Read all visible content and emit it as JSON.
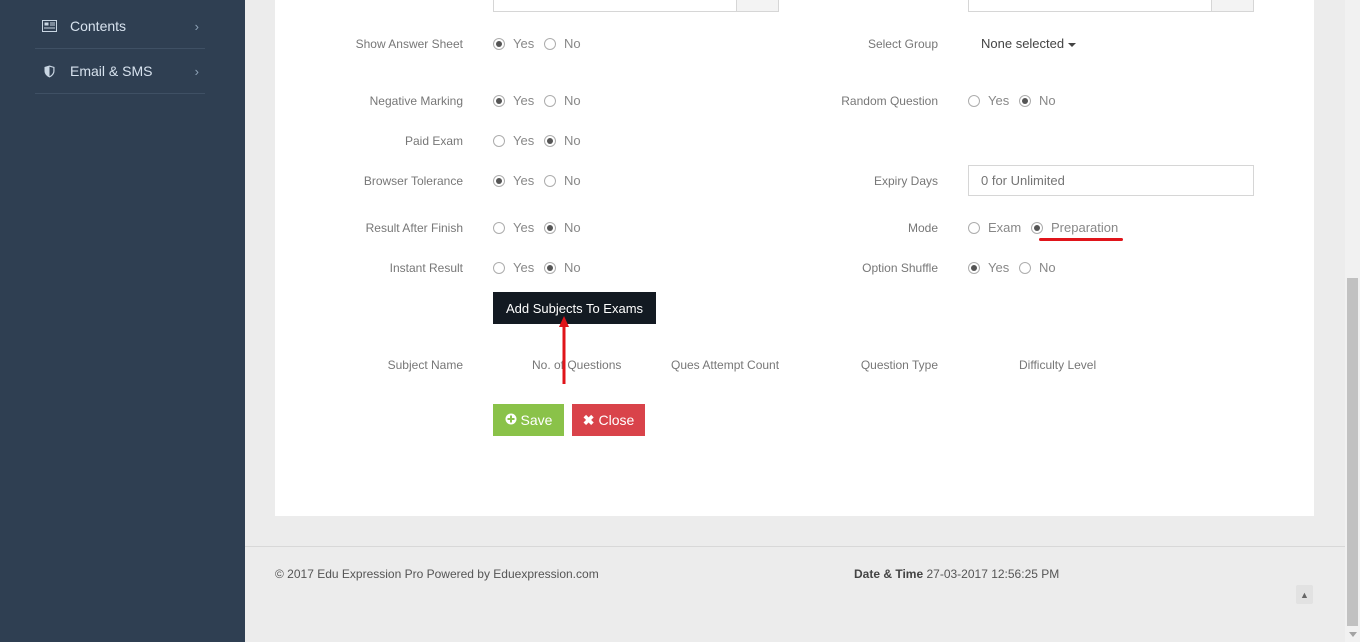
{
  "sidebar": {
    "items": [
      {
        "label": "Contents",
        "icon": "newspaper-icon"
      },
      {
        "label": "Email & SMS",
        "icon": "shield-icon"
      }
    ]
  },
  "form": {
    "show_answer_sheet": {
      "label": "Show Answer Sheet",
      "yes": "Yes",
      "no": "No",
      "selected": "Yes"
    },
    "select_group": {
      "label": "Select Group",
      "value": "None selected"
    },
    "negative_marking": {
      "label": "Negative Marking",
      "yes": "Yes",
      "no": "No",
      "selected": "Yes"
    },
    "random_question": {
      "label": "Random Question",
      "yes": "Yes",
      "no": "No",
      "selected": "No"
    },
    "paid_exam": {
      "label": "Paid Exam",
      "yes": "Yes",
      "no": "No",
      "selected": "No"
    },
    "browser_tolerance": {
      "label": "Browser Tolerance",
      "yes": "Yes",
      "no": "No",
      "selected": "Yes"
    },
    "expiry_days": {
      "label": "Expiry Days",
      "placeholder": "0 for Unlimited"
    },
    "result_after_finish": {
      "label": "Result After Finish",
      "yes": "Yes",
      "no": "No",
      "selected": "No"
    },
    "mode": {
      "label": "Mode",
      "exam": "Exam",
      "preparation": "Preparation",
      "selected": "Preparation"
    },
    "instant_result": {
      "label": "Instant Result",
      "yes": "Yes",
      "no": "No",
      "selected": "No"
    },
    "option_shuffle": {
      "label": "Option Shuffle",
      "yes": "Yes",
      "no": "No",
      "selected": "Yes"
    }
  },
  "add_subjects_button": "Add Subjects To Exams",
  "subject_table": {
    "headers": [
      "Subject Name",
      "No. of Questions",
      "Ques Attempt Count",
      "Question Type",
      "Difficulty Level"
    ]
  },
  "actions": {
    "save": "Save",
    "close": "Close"
  },
  "footer": {
    "copyright": "© 2017 Edu Expression Pro Powered by Eduexpression.com",
    "datetime_label": "Date & Time",
    "datetime_value": "27-03-2017 12:56:25 PM"
  },
  "colors": {
    "sidebar": "#2f3f52",
    "save": "#8ac249",
    "close": "#d9434a",
    "dark_button": "#131a22",
    "annotation": "#e0141a"
  }
}
